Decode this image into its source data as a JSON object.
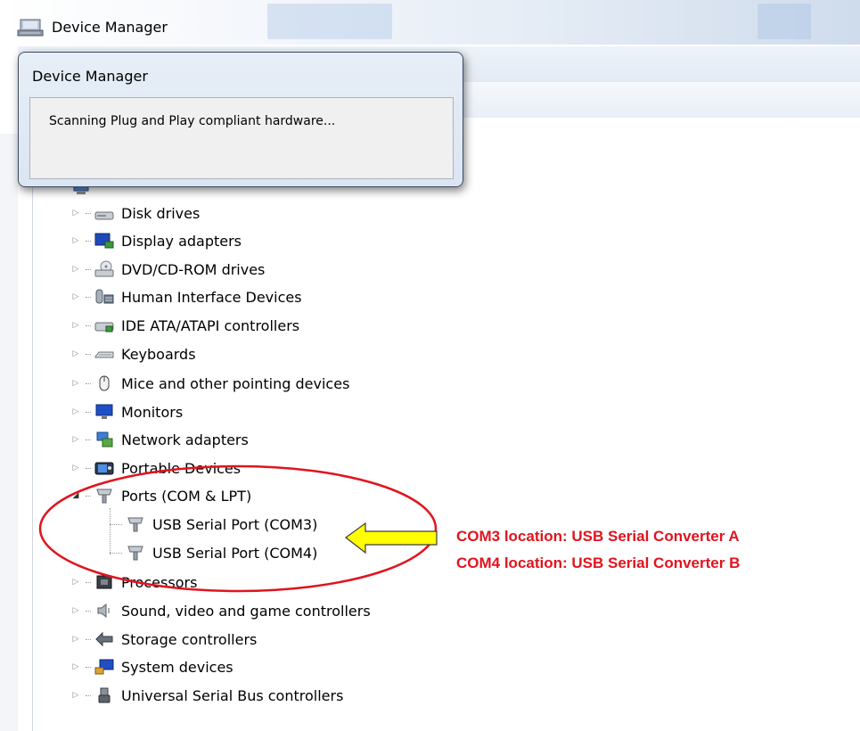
{
  "window": {
    "title": "Device Manager",
    "icon": "device-manager-icon"
  },
  "dialog": {
    "title": "Device Manager",
    "message": "Scanning Plug and Play compliant hardware..."
  },
  "tree": [
    {
      "label": "Disk drives",
      "icon": "disk-drive-icon",
      "expanded": false
    },
    {
      "label": "Display adapters",
      "icon": "display-adapter-icon",
      "expanded": false
    },
    {
      "label": "DVD/CD-ROM drives",
      "icon": "dvd-drive-icon",
      "expanded": false
    },
    {
      "label": "Human Interface Devices",
      "icon": "hid-icon",
      "expanded": false
    },
    {
      "label": "IDE ATA/ATAPI controllers",
      "icon": "ide-controller-icon",
      "expanded": false
    },
    {
      "label": "Keyboards",
      "icon": "keyboard-icon",
      "expanded": false
    },
    {
      "label": "Mice and other pointing devices",
      "icon": "mouse-icon",
      "expanded": false
    },
    {
      "label": "Monitors",
      "icon": "monitor-icon",
      "expanded": false
    },
    {
      "label": "Network adapters",
      "icon": "network-adapter-icon",
      "expanded": false
    },
    {
      "label": "Portable Devices",
      "icon": "portable-device-icon",
      "expanded": false
    },
    {
      "label": "Ports (COM & LPT)",
      "icon": "port-icon",
      "expanded": true,
      "children": [
        {
          "label": "USB Serial Port (COM3)",
          "icon": "serial-port-icon"
        },
        {
          "label": "USB Serial Port (COM4)",
          "icon": "serial-port-icon"
        }
      ]
    },
    {
      "label": "Processors",
      "icon": "processor-icon",
      "expanded": false
    },
    {
      "label": "Sound, video and game controllers",
      "icon": "speaker-icon",
      "expanded": false
    },
    {
      "label": "Storage controllers",
      "icon": "storage-controller-icon",
      "expanded": false
    },
    {
      "label": "System devices",
      "icon": "system-device-icon",
      "expanded": false
    },
    {
      "label": "Universal Serial Bus controllers",
      "icon": "usb-icon",
      "expanded": false
    }
  ],
  "annotation": {
    "line1": "COM3 location:  USB Serial Converter A",
    "line2": "COM4 location:  USB Serial Converter B",
    "color": "#e0141e",
    "arrow_color": "#ffff00"
  }
}
